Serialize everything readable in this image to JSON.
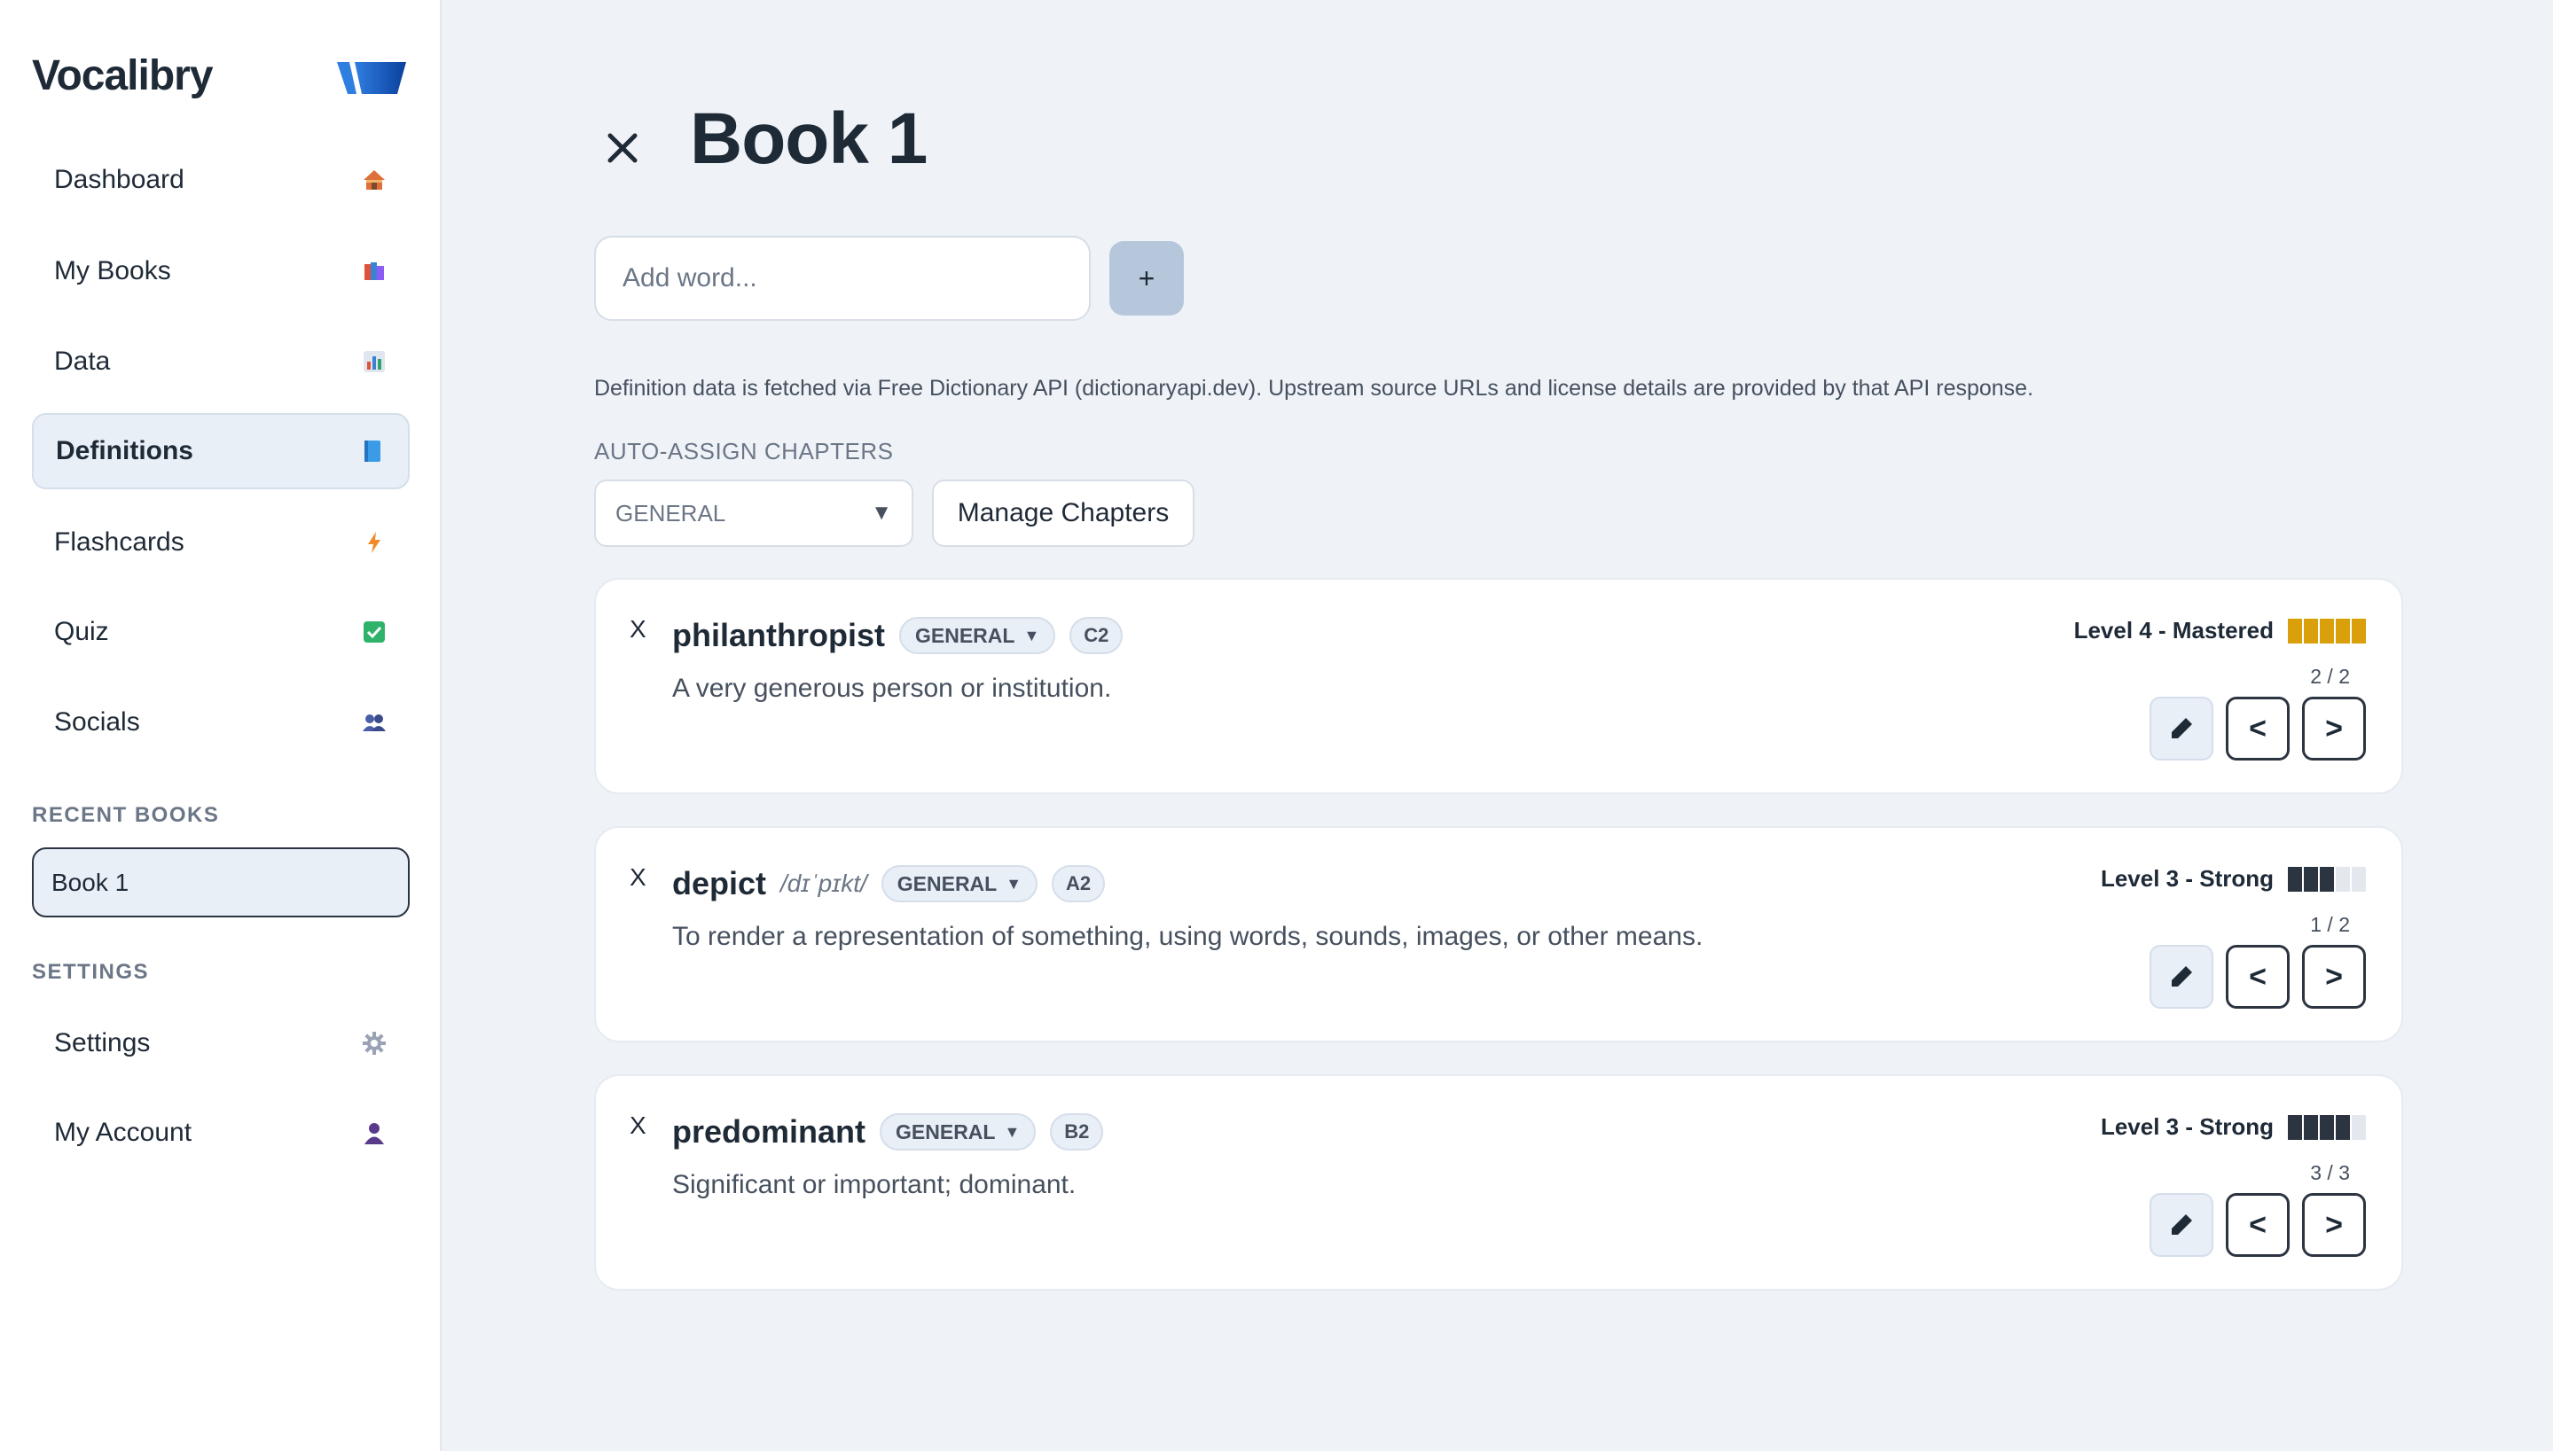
{
  "sidebar": {
    "brand": "Vocalibry",
    "nav": [
      {
        "label": "Dashboard",
        "icon": "house-icon"
      },
      {
        "label": "My Books",
        "icon": "books-icon"
      },
      {
        "label": "Data",
        "icon": "bar-chart-icon"
      },
      {
        "label": "Definitions",
        "icon": "blue-book-icon",
        "active": true
      },
      {
        "label": "Flashcards",
        "icon": "lightning-icon"
      },
      {
        "label": "Quiz",
        "icon": "check-box-icon"
      },
      {
        "label": "Socials",
        "icon": "people-icon"
      }
    ],
    "recent_label": "RECENT BOOKS",
    "recent_books": [
      "Book 1"
    ],
    "settings_label": "SETTINGS",
    "settings_items": [
      {
        "label": "Settings",
        "icon": "gear-icon"
      },
      {
        "label": "My Account",
        "icon": "user-icon"
      }
    ]
  },
  "main": {
    "title": "Book 1",
    "add_word": {
      "placeholder": "Add word...",
      "button": "+"
    },
    "note": "Definition data is fetched via Free Dictionary API (dictionaryapi.dev). Upstream source URLs and license details are provided by that API response.",
    "chapters": {
      "label": "AUTO-ASSIGN CHAPTERS",
      "selected": "GENERAL",
      "manage_label": "Manage Chapters"
    },
    "words": [
      {
        "delete": "X",
        "word": "philanthropist",
        "phonetic": "",
        "chapter": "GENERAL",
        "cefr": "C2",
        "definition": "A very generous person or institution.",
        "level_text": "Level 4 - Mastered",
        "level_filled": 5,
        "level_color": "#d9a00b",
        "pager": "2 / 2"
      },
      {
        "delete": "X",
        "word": "depict",
        "phonetic": "/dɪˈpɪkt/",
        "chapter": "GENERAL",
        "cefr": "A2",
        "definition": "To render a representation of something, using words, sounds, images, or other means.",
        "level_text": "Level 3 - Strong",
        "level_filled": 3,
        "level_color": "#2b3440",
        "pager": "1 / 2"
      },
      {
        "delete": "X",
        "word": "predominant",
        "phonetic": "",
        "chapter": "GENERAL",
        "cefr": "B2",
        "definition": "Significant or important; dominant.",
        "level_text": "Level 3 - Strong",
        "level_filled": 4,
        "level_color": "#2b3440",
        "pager": "3 / 3"
      }
    ],
    "edit_icon": "pencil-icon",
    "prev_label": "<",
    "next_label": ">"
  }
}
